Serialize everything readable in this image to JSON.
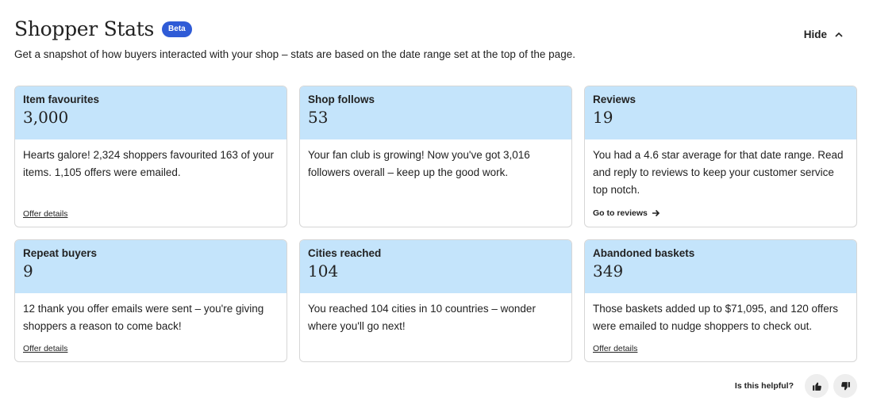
{
  "header": {
    "title": "Shopper Stats",
    "badge": "Beta",
    "subtitle": "Get a snapshot of how buyers interacted with your shop – stats are based on the date range set at the top of the page.",
    "hide_label": "Hide",
    "hide_icon": "chevron-up-icon"
  },
  "cards": [
    {
      "label": "Item favourites",
      "value": "3,000",
      "body": "Hearts galore! 2,324 shoppers favourited 163 of your items. 1,105 offers were emailed.",
      "link": "Offer details"
    },
    {
      "label": "Shop follows",
      "value": "53",
      "body": "Your fan club is growing! Now you've got 3,016 followers overall – keep up the good work."
    },
    {
      "label": "Reviews",
      "value": "19",
      "body": "You had a 4.6 star average for that date range. Read and reply to reviews to keep your customer service top notch.",
      "link": "Go to reviews",
      "link_icon": "arrow-right-icon"
    },
    {
      "label": "Repeat buyers",
      "value": "9",
      "body": "12 thank you offer emails were sent – you're giving shoppers a reason to come back!",
      "link": "Offer details"
    },
    {
      "label": "Cities reached",
      "value": "104",
      "body": "You reached 104 cities in 10 countries – wonder where you'll go next!"
    },
    {
      "label": "Abandoned baskets",
      "value": "349",
      "body": "Those baskets added up to $71,095, and 120 offers were emailed to nudge shoppers to check out.",
      "link": "Offer details"
    }
  ],
  "feedback": {
    "label": "Is this helpful?",
    "up_icon": "thumbs-up-icon",
    "down_icon": "thumbs-down-icon"
  },
  "colors": {
    "card_header_bg": "#c4e4fb",
    "badge_bg": "#2f5bd6"
  }
}
